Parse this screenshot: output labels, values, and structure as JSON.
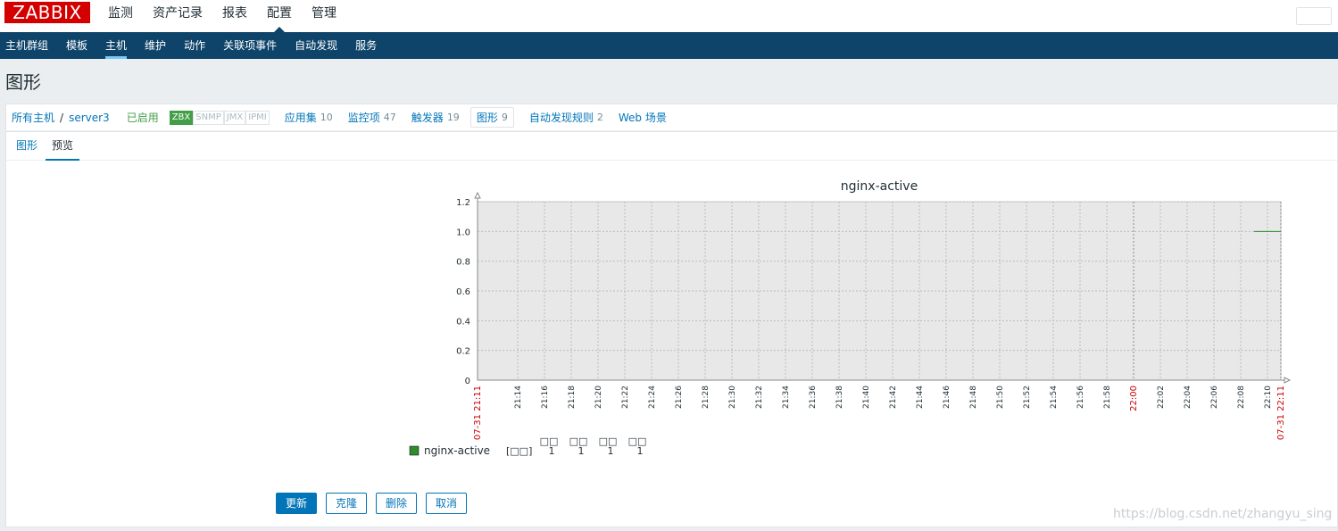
{
  "app": {
    "logo": "ZABBIX"
  },
  "topnav": {
    "items": [
      "监测",
      "资产记录",
      "报表",
      "配置",
      "管理"
    ]
  },
  "subnav": {
    "items": [
      "主机群组",
      "模板",
      "主机",
      "维护",
      "动作",
      "关联项事件",
      "自动发现",
      "服务"
    ]
  },
  "page": {
    "title": "图形"
  },
  "hostnav": {
    "all_hosts": "所有主机",
    "separator": "/",
    "host": "server3",
    "status": "已启用",
    "badges": [
      "ZBX",
      "SNMP",
      "JMX",
      "IPMI"
    ],
    "links": [
      {
        "label": "应用集",
        "count": "10"
      },
      {
        "label": "监控项",
        "count": "47"
      },
      {
        "label": "触发器",
        "count": "19"
      },
      {
        "label": "图形",
        "count": "9"
      },
      {
        "label": "自动发现规则",
        "count": "2"
      },
      {
        "label": "Web 场景",
        "count": ""
      }
    ]
  },
  "tabs": [
    "图形",
    "预览"
  ],
  "chart_data": {
    "type": "line",
    "title": "nginx-active",
    "ylim": [
      0,
      1.2
    ],
    "y_ticks": [
      "0",
      "0.2",
      "0.4",
      "0.6",
      "0.8",
      "1.0",
      "1.2"
    ],
    "x_ticks": [
      "07-31 21:11",
      "21:14",
      "21:16",
      "21:18",
      "21:20",
      "21:22",
      "21:24",
      "21:26",
      "21:28",
      "21:30",
      "21:32",
      "21:34",
      "21:36",
      "21:38",
      "21:40",
      "21:42",
      "21:44",
      "21:46",
      "21:48",
      "21:50",
      "21:52",
      "21:54",
      "21:56",
      "21:58",
      "22:00",
      "22:02",
      "22:04",
      "22:06",
      "22:08",
      "22:10",
      "07-31 22:11"
    ],
    "x_range": [
      "21:11",
      "22:11"
    ],
    "series": [
      {
        "name": "nginx-active",
        "color": "#2e8b2e",
        "x": [
          "22:09",
          "22:11"
        ],
        "values": [
          1,
          1
        ]
      }
    ],
    "legend": {
      "function": "[□□]",
      "columns": [
        "□□",
        "□□",
        "□□",
        "□□"
      ],
      "values": [
        "1",
        "1",
        "1",
        "1"
      ]
    }
  },
  "buttons": {
    "update": "更新",
    "clone": "克隆",
    "delete": "删除",
    "cancel": "取消"
  },
  "watermark": "https://blog.csdn.net/zhangyu_sing"
}
